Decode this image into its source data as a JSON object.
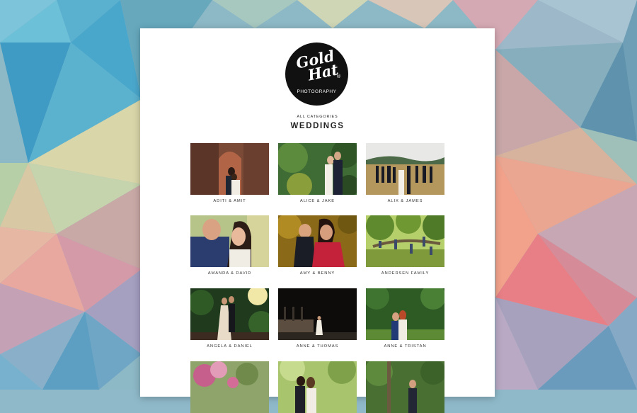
{
  "logo": {
    "script_line1": "Gold",
    "script_line2": "Hat",
    "trademark": "®",
    "subtitle": "PHOTOGRAPHY"
  },
  "breadcrumb": "ALL CATEGORIES",
  "page_title": "WEDDINGS",
  "galleries": [
    {
      "label": "ADITI & AMIT"
    },
    {
      "label": "ALICE & JAKE"
    },
    {
      "label": "ALIX & JAMES"
    },
    {
      "label": "AMANDA & DAVID"
    },
    {
      "label": "AMY & BENNY"
    },
    {
      "label": "ANDERSEN FAMILY"
    },
    {
      "label": "ANGELA & DANIEL"
    },
    {
      "label": "ANNE & THOMAS"
    },
    {
      "label": "ANNE & TRISTAN"
    },
    {
      "label": ""
    },
    {
      "label": ""
    },
    {
      "label": ""
    }
  ],
  "colors": {
    "page_bg": "#ffffff",
    "logo_bg": "#111111",
    "text": "#333333"
  }
}
